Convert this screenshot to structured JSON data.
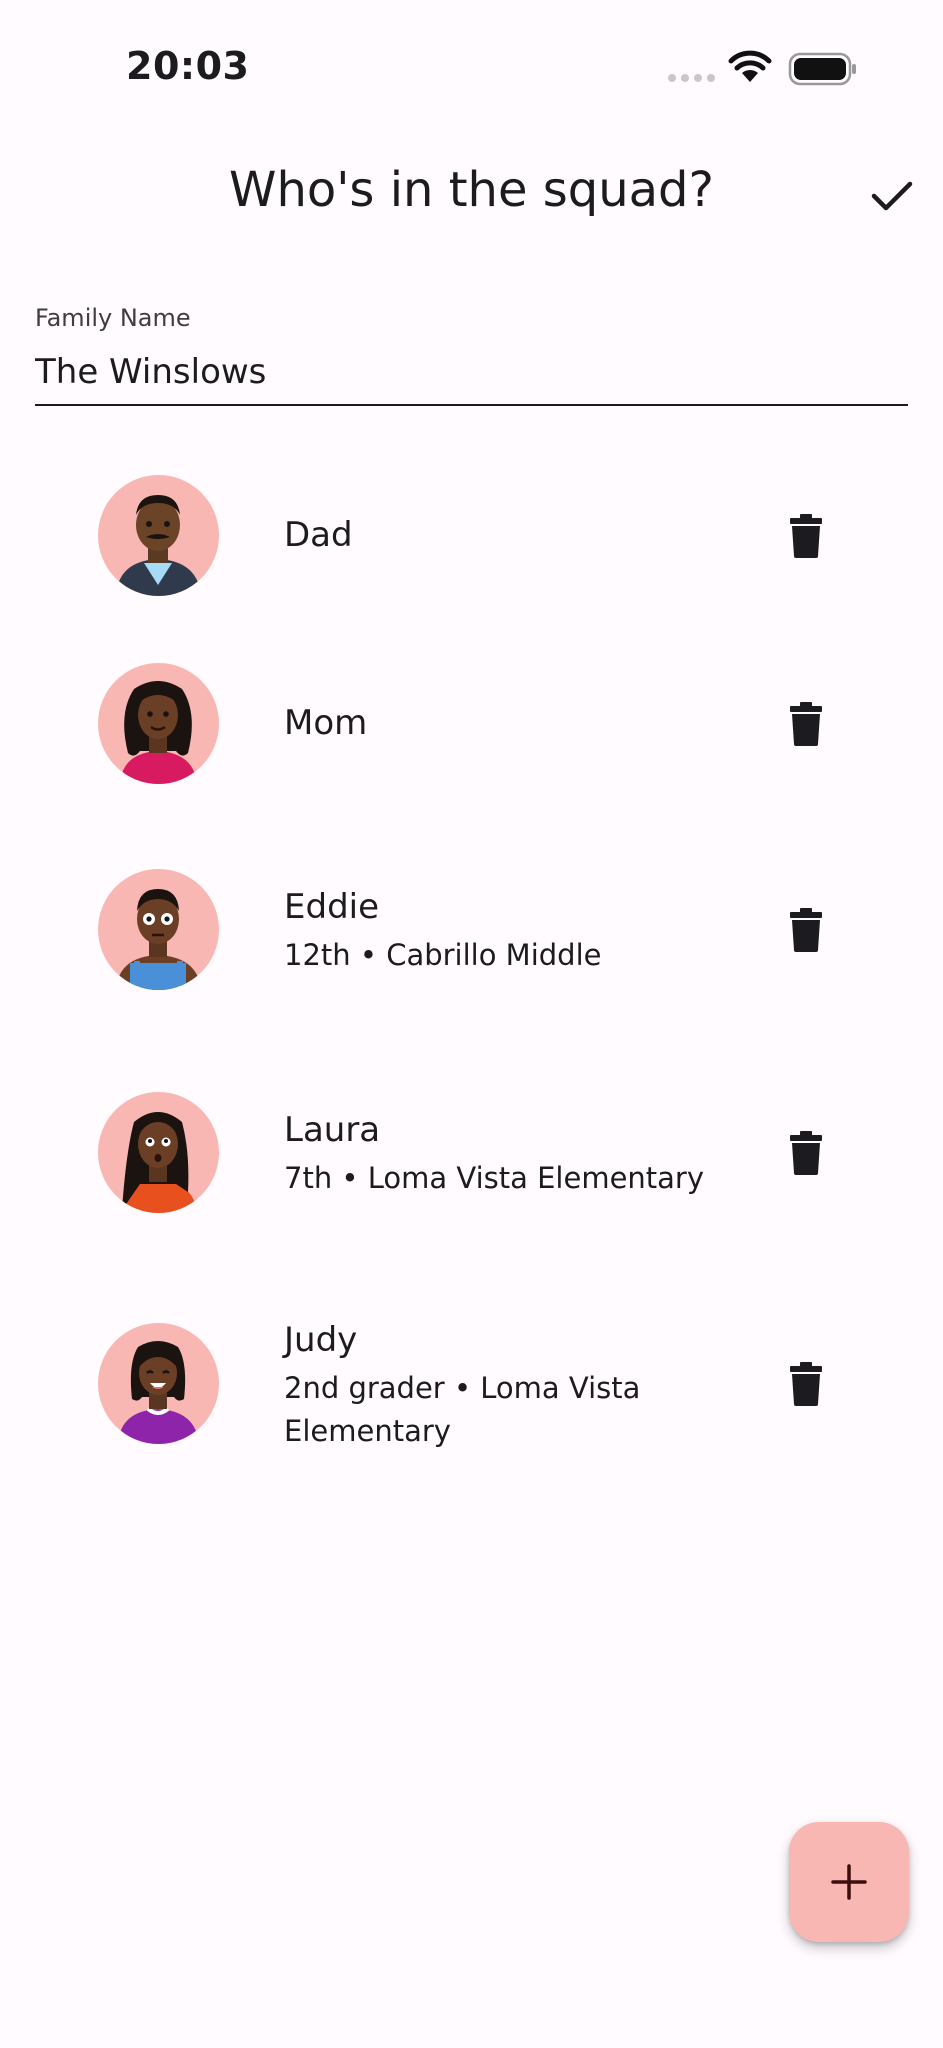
{
  "status_bar": {
    "time": "20:03"
  },
  "app_bar": {
    "title": "Who's in the squad?",
    "confirm_icon": "check-icon"
  },
  "family_field": {
    "label": "Family Name",
    "value": "The Winslows"
  },
  "members": [
    {
      "name": "Dad",
      "subtitle": "",
      "avatar_color": "#f9b7b3",
      "shirt_color": "#2f3b4c"
    },
    {
      "name": "Mom",
      "subtitle": "",
      "avatar_color": "#f9b7b3",
      "shirt_color": "#d81b60"
    },
    {
      "name": "Eddie",
      "subtitle": "12th • Cabrillo Middle",
      "avatar_color": "#f9b7b3",
      "shirt_color": "#4a90d9"
    },
    {
      "name": "Laura",
      "subtitle": "7th • Loma Vista Elementary",
      "avatar_color": "#f9b7b3",
      "shirt_color": "#e8501e"
    },
    {
      "name": "Judy",
      "subtitle": "2nd grader • Loma Vista Elementary",
      "avatar_color": "#f9b7b3",
      "shirt_color": "#8e24aa"
    }
  ],
  "icons": {
    "delete": "trash-icon",
    "add": "plus-icon"
  },
  "colors": {
    "background": "#fffbfe",
    "accent": "#f9b7b3",
    "text": "#1c1b1f"
  }
}
